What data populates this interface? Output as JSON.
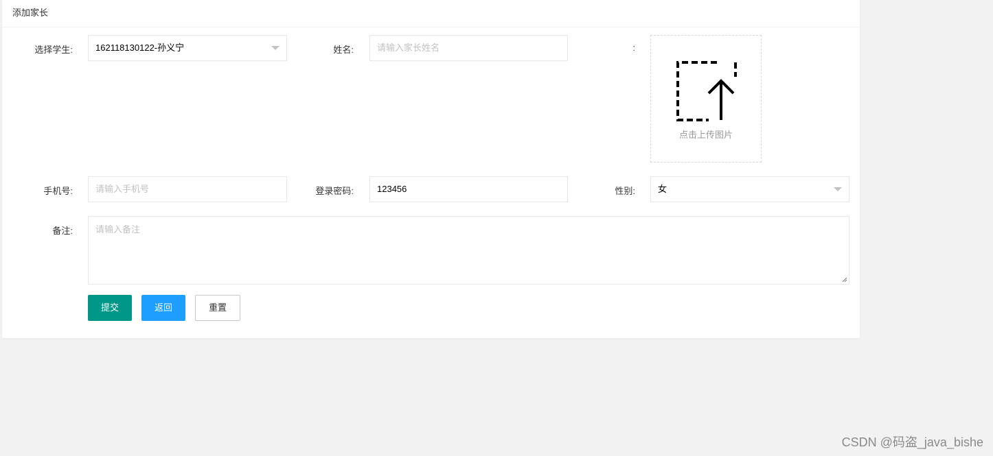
{
  "header": {
    "title": "添加家长"
  },
  "form": {
    "student": {
      "label": "选择学生:",
      "value": "162118130122-孙义宁"
    },
    "name": {
      "label": "姓名:",
      "placeholder": "请输入家长姓名"
    },
    "image": {
      "label": ":",
      "upload_text": "点击上传图片",
      "icon": "upload-icon"
    },
    "phone": {
      "label": "手机号:",
      "placeholder": "请输入手机号"
    },
    "password": {
      "label": "登录密码:",
      "value": "123456"
    },
    "gender": {
      "label": "性别:",
      "value": "女"
    },
    "remark": {
      "label": "备注:",
      "placeholder": "请输入备注"
    }
  },
  "buttons": {
    "submit": "提交",
    "back": "返回",
    "reset": "重置"
  },
  "colors": {
    "submit": "#009688",
    "back": "#1e9fff",
    "background": "#f2f2f2"
  },
  "watermark": "CSDN @码盗_java_bishe"
}
